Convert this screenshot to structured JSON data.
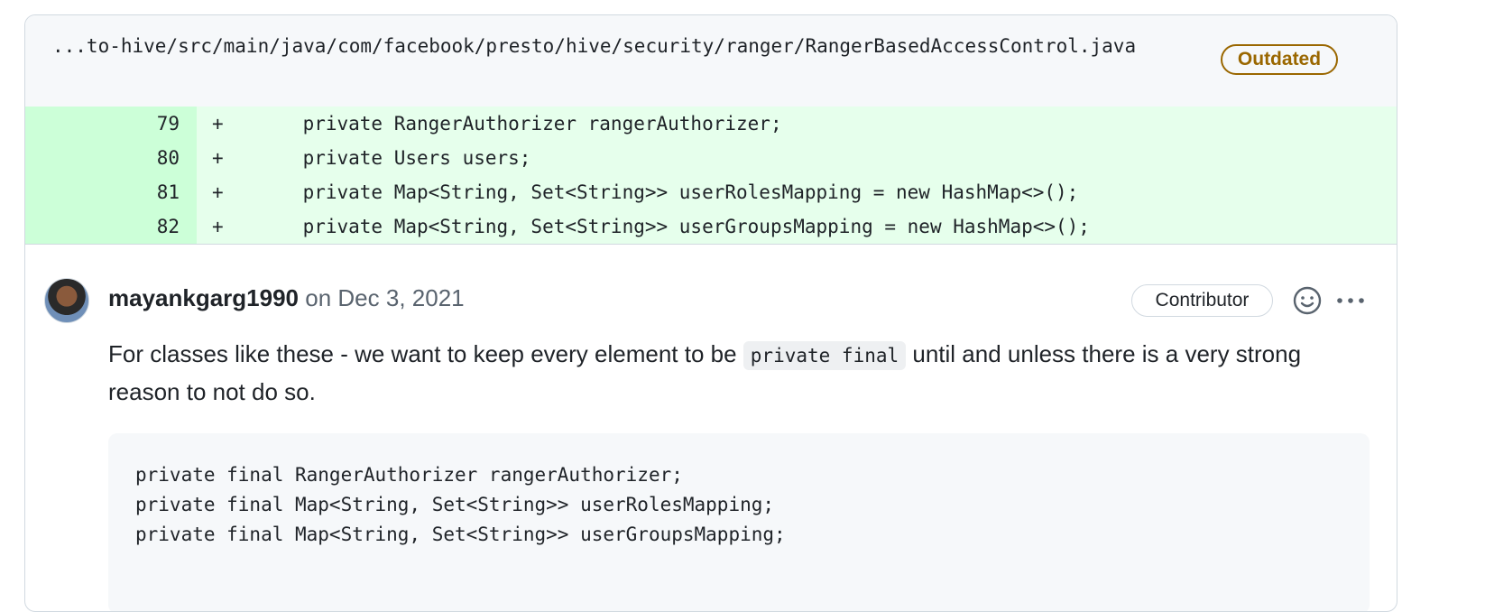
{
  "file": {
    "path": "...to-hive/src/main/java/com/facebook/presto/hive/security/ranger/RangerBasedAccessControl.java",
    "status_badge": "Outdated"
  },
  "diff": {
    "lines": [
      {
        "number": "79",
        "sign": "+",
        "code": "    private RangerAuthorizer rangerAuthorizer;"
      },
      {
        "number": "80",
        "sign": "+",
        "code": "    private Users users;"
      },
      {
        "number": "81",
        "sign": "+",
        "code": "    private Map<String, Set<String>> userRolesMapping = new HashMap<>();"
      },
      {
        "number": "82",
        "sign": "+",
        "code": "    private Map<String, Set<String>> userGroupsMapping = new HashMap<>();"
      }
    ]
  },
  "comment": {
    "author": "mayankgarg1990",
    "date": "on Dec 3, 2021",
    "role_badge": "Contributor",
    "icons": {
      "reaction": "smiley-icon",
      "more": "kebab-horizontal-icon",
      "avatar": "avatar"
    },
    "text_before": "For classes like these - we want to keep every element to be ",
    "inline_code": "private final",
    "text_after": " until and unless there is a very strong reason to not do so.",
    "code_block": [
      "private final RangerAuthorizer rangerAuthorizer;",
      "private final Map<String, Set<String>> userRolesMapping;",
      "private final Map<String, Set<String>> userGroupsMapping;"
    ]
  },
  "colors": {
    "added_bg": "#e6ffec",
    "added_num_bg": "#ccffd8",
    "outdated": "#9a6700"
  }
}
